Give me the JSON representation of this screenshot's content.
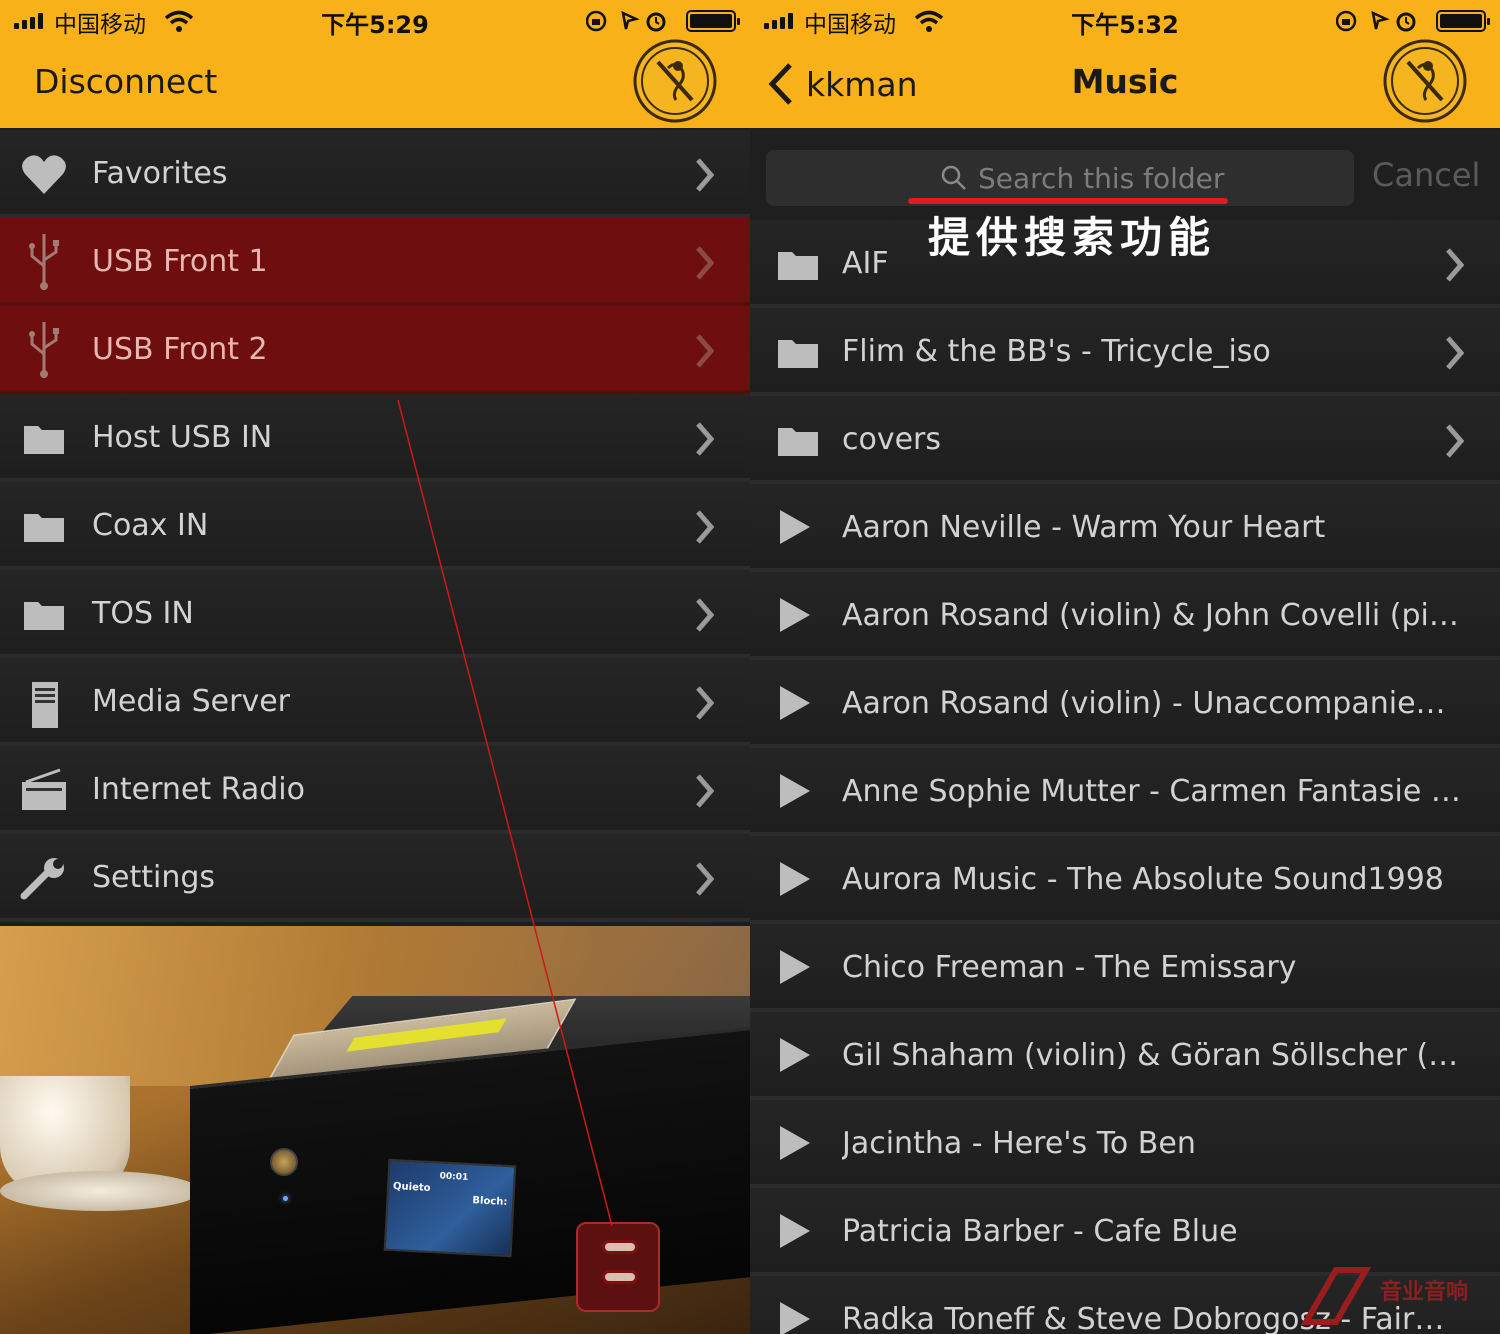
{
  "left_screen": {
    "status": {
      "carrier": "中国移动",
      "time": "下午5:29"
    },
    "nav": {
      "left_button": "Disconnect"
    },
    "menu": [
      {
        "label": "Favorites",
        "icon": "heart-icon",
        "highlighted": false
      },
      {
        "label": "USB Front 1",
        "icon": "usb-icon",
        "highlighted": true
      },
      {
        "label": "USB Front 2",
        "icon": "usb-icon",
        "highlighted": true
      },
      {
        "label": "Host USB IN",
        "icon": "folder-icon",
        "highlighted": false
      },
      {
        "label": "Coax IN",
        "icon": "folder-icon",
        "highlighted": false
      },
      {
        "label": "TOS IN",
        "icon": "folder-icon",
        "highlighted": false
      },
      {
        "label": "Media Server",
        "icon": "server-icon",
        "highlighted": false
      },
      {
        "label": "Internet Radio",
        "icon": "radio-icon",
        "highlighted": false
      },
      {
        "label": "Settings",
        "icon": "wrench-icon",
        "highlighted": false
      }
    ],
    "photo_display": {
      "time": "00:01",
      "title_a": "Quieto",
      "title_b": "Bloch:"
    }
  },
  "right_screen": {
    "status": {
      "carrier": "中国移动",
      "time": "下午5:32"
    },
    "nav": {
      "back_label": "kkman",
      "title": "Music"
    },
    "search": {
      "placeholder": "Search this folder",
      "cancel_label": "Cancel"
    },
    "annotation": "提供搜索功能",
    "items": [
      {
        "label": "AIF",
        "type": "folder"
      },
      {
        "label": "Flim & the BB's - Tricycle_iso",
        "type": "folder"
      },
      {
        "label": "covers",
        "type": "folder"
      },
      {
        "label": "Aaron Neville - Warm Your Heart",
        "type": "track"
      },
      {
        "label": "Aaron Rosand (violin) & John Covelli (pian…",
        "type": "track"
      },
      {
        "label": "Aaron Rosand (violin) - Unaccompanied Vi…",
        "type": "track"
      },
      {
        "label": "Anne Sophie Mutter - Carmen Fantasie -…",
        "type": "track"
      },
      {
        "label": "Aurora Music - The Absolute Sound1998",
        "type": "track"
      },
      {
        "label": "Chico Freeman - The Emissary",
        "type": "track"
      },
      {
        "label": "Gil Shaham (violin) & Göran Söllscher (gui…",
        "type": "track"
      },
      {
        "label": "Jacintha - Here's To Ben",
        "type": "track"
      },
      {
        "label": "Patricia Barber - Cafe Blue",
        "type": "track"
      },
      {
        "label": "Radka Toneff & Steve Dobrogosz - Fairytales",
        "type": "track"
      }
    ],
    "watermark": "音业音响"
  },
  "colors": {
    "accent": "#f9b11a",
    "highlight": "#6e0e0e",
    "annotation_red": "#e21b1b"
  }
}
